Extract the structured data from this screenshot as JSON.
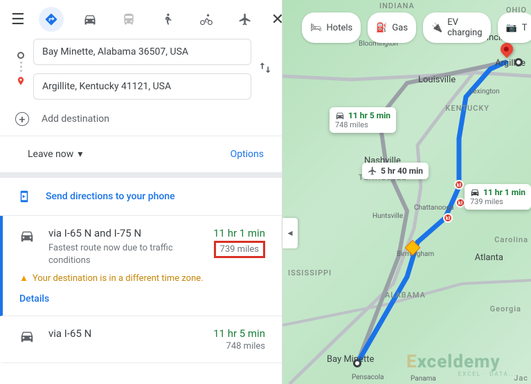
{
  "topbar": {
    "close_title": "Close"
  },
  "inputs": {
    "origin": "Bay Minette, Alabama 36507, USA",
    "destination": "Argillite, Kentucky 41121, USA",
    "add_destination_label": "Add destination"
  },
  "departure": {
    "leave_label": "Leave now",
    "options_label": "Options"
  },
  "send_phone_label": "Send directions to your phone",
  "routes": [
    {
      "title": "via I-65 N and I-75 N",
      "subtitle": "Fastest route now due to traffic conditions",
      "time": "11 hr 1 min",
      "distance": "739 miles",
      "timezone_warning": "Your destination is in a different time zone.",
      "details_label": "Details"
    },
    {
      "title": "via I-65 N",
      "time": "11 hr 5 min",
      "distance": "748 miles"
    }
  ],
  "map": {
    "chips": {
      "hotels": "Hotels",
      "gas": "Gas",
      "ev": "EV charging",
      "things": "T"
    },
    "badges": {
      "alt_car": {
        "time": "11 hr 5 min",
        "dist": "748 miles"
      },
      "flight": {
        "time": "5 hr 40 min"
      },
      "main_car": {
        "time": "11 hr 1 min",
        "dist": "739 miles"
      }
    },
    "cities": {
      "bay_minette": "Bay Minette",
      "argillite": "Argillite",
      "louisville": "Louisville",
      "lexington": "Lexington",
      "cincinnati": "Cincinnati",
      "nashville": "Nashville",
      "huntsville": "Huntsville",
      "birmingham": "Birmingham",
      "chattanooga": "Chattanooga",
      "atlanta": "Atlanta",
      "bloomington": "Bloomington",
      "pensacola": "Pensacola",
      "panama": "Panama"
    },
    "states": {
      "indiana": "INDIANA",
      "ohio": "OHIO",
      "kentucky": "KENTUCKY",
      "tennessee": "TENNESSEE",
      "mississippi": "ISSISSIPPI",
      "alabama": "ALABAMA",
      "georgia": "Georgia",
      "carolina": "Carolina",
      "jac": "Jac"
    }
  }
}
